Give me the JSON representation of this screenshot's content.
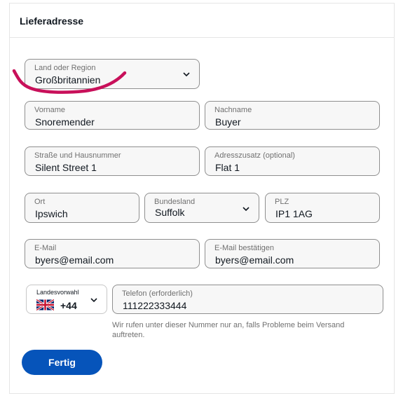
{
  "header": {
    "title": "Lieferadresse"
  },
  "form": {
    "country": {
      "label": "Land oder Region",
      "value": "Großbritannien"
    },
    "first_name": {
      "label": "Vorname",
      "value": "Snoremender"
    },
    "last_name": {
      "label": "Nachname",
      "value": "Buyer"
    },
    "street": {
      "label": "Straße und Hausnummer",
      "value": "Silent Street 1"
    },
    "address2": {
      "label": "Adresszusatz (optional)",
      "value": "Flat 1"
    },
    "city": {
      "label": "Ort",
      "value": "Ipswich"
    },
    "state": {
      "label": "Bundesland",
      "value": "Suffolk"
    },
    "zip": {
      "label": "PLZ",
      "value": "IP1 1AG"
    },
    "email": {
      "label": "E-Mail",
      "value": "byers@email.com"
    },
    "email_confirm": {
      "label": "E-Mail bestätigen",
      "value": "byers@email.com"
    },
    "country_code": {
      "label": "Landesvorwahl",
      "value": "+44",
      "flag_icon": "uk-flag-icon"
    },
    "phone": {
      "label": "Telefon (erforderlich)",
      "value": "111222333444"
    },
    "phone_help": "Wir rufen unter dieser Nummer nur an, falls Probleme beim Versand auftreten."
  },
  "actions": {
    "done_label": "Fertig"
  },
  "colors": {
    "primary": "#0654ba",
    "annotation": "#c8105a",
    "field_bg": "#f7f7f7",
    "field_border": "#8f8f8f"
  }
}
